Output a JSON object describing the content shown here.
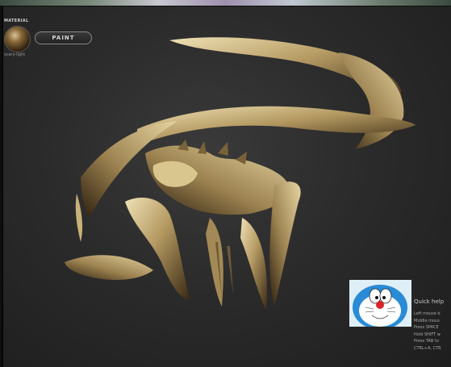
{
  "material_panel": {
    "label": "MATERIAL",
    "material_name": "scary-light",
    "icon": "material-sphere-icon"
  },
  "toolbar": {
    "paint_label": "PAINT"
  },
  "model": {
    "icon": "sculpt-model-icon",
    "colors": {
      "highlight": "#e9d9a8",
      "mid": "#b59a62",
      "shadow": "#3a2a14"
    }
  },
  "thumbnail": {
    "icon": "doraemon-face-icon"
  },
  "quick_help": {
    "title": "Quick help",
    "lines": [
      "Left mouse b",
      "Middle mous",
      "Press SPACE",
      "Hold SHIFT w",
      "Press TAB to",
      "CTRL+A, CTR"
    ]
  }
}
